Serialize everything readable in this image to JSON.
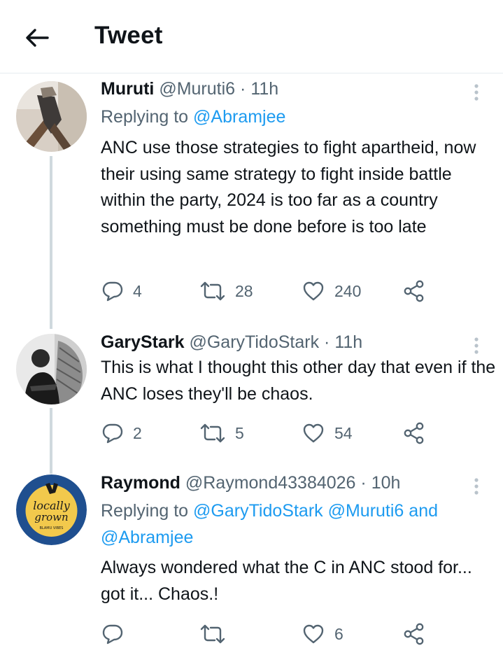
{
  "header": {
    "title": "Tweet",
    "back_icon": "arrow-left-icon"
  },
  "colors": {
    "mention": "#1d9bf0",
    "secondary_text": "#536471",
    "thread_line": "#cfd9de",
    "divider": "#e6ecf0"
  },
  "tweets": [
    {
      "name": "Muruti",
      "handle": "@Muruti6",
      "separator": "·",
      "time": "11h",
      "replying_prefix": "Replying to",
      "replying_to": "@Abramjee",
      "text": "ANC use those strategies to fight apartheid, now their using same strategy to fight inside battle within the party, 2024 is too far as a country something must be done before is too late",
      "replies": "4",
      "retweets": "28",
      "likes": "240"
    },
    {
      "name": "GaryStark",
      "handle": "@GaryTidoStark",
      "separator": "·",
      "time": "11h",
      "text": "This is what I thought this other day that even if the ANC loses they'll be chaos.",
      "replies": "2",
      "retweets": "5",
      "likes": "54"
    },
    {
      "name": "Raymond",
      "handle": "@Raymond43384026",
      "separator": "·",
      "time": "10h",
      "replying_prefix": "Replying to",
      "replying_to_1": "@GaryTidoStark",
      "replying_to_2": "@Muruti6",
      "replying_and": "and",
      "replying_to_3": "@Abramjee",
      "text": "Always wondered what the C in ANC stood for... got it... Chaos.!",
      "replies": "",
      "retweets": "",
      "likes": "6",
      "avatar_text_1": "locally",
      "avatar_text_2": "grown",
      "avatar_text_3": "BLAMU VIBES"
    }
  ]
}
